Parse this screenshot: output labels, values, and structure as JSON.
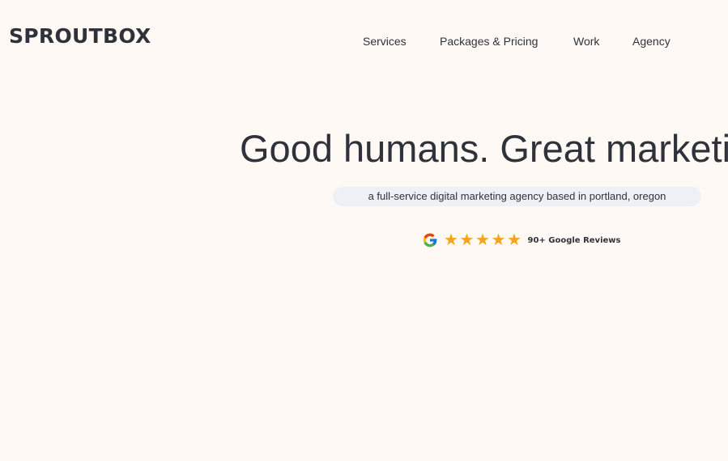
{
  "header": {
    "logo_text": "SPROUTBOX",
    "nav": [
      {
        "label": "Services"
      },
      {
        "label": "Packages & Pricing"
      },
      {
        "label": "Work"
      },
      {
        "label": "Agency"
      }
    ]
  },
  "hero": {
    "title": "Good humans. Great marketing.",
    "tagline": "a full-service digital marketing agency based in portland, oregon",
    "reviews": {
      "icon": "google-g-icon",
      "rating_stars": 5,
      "star_color": "#f6a21a",
      "label": "90+ Google Reviews"
    }
  },
  "colors": {
    "background": "#fef9f4",
    "text": "#2f323a",
    "pill_background": "#edf1f6"
  }
}
